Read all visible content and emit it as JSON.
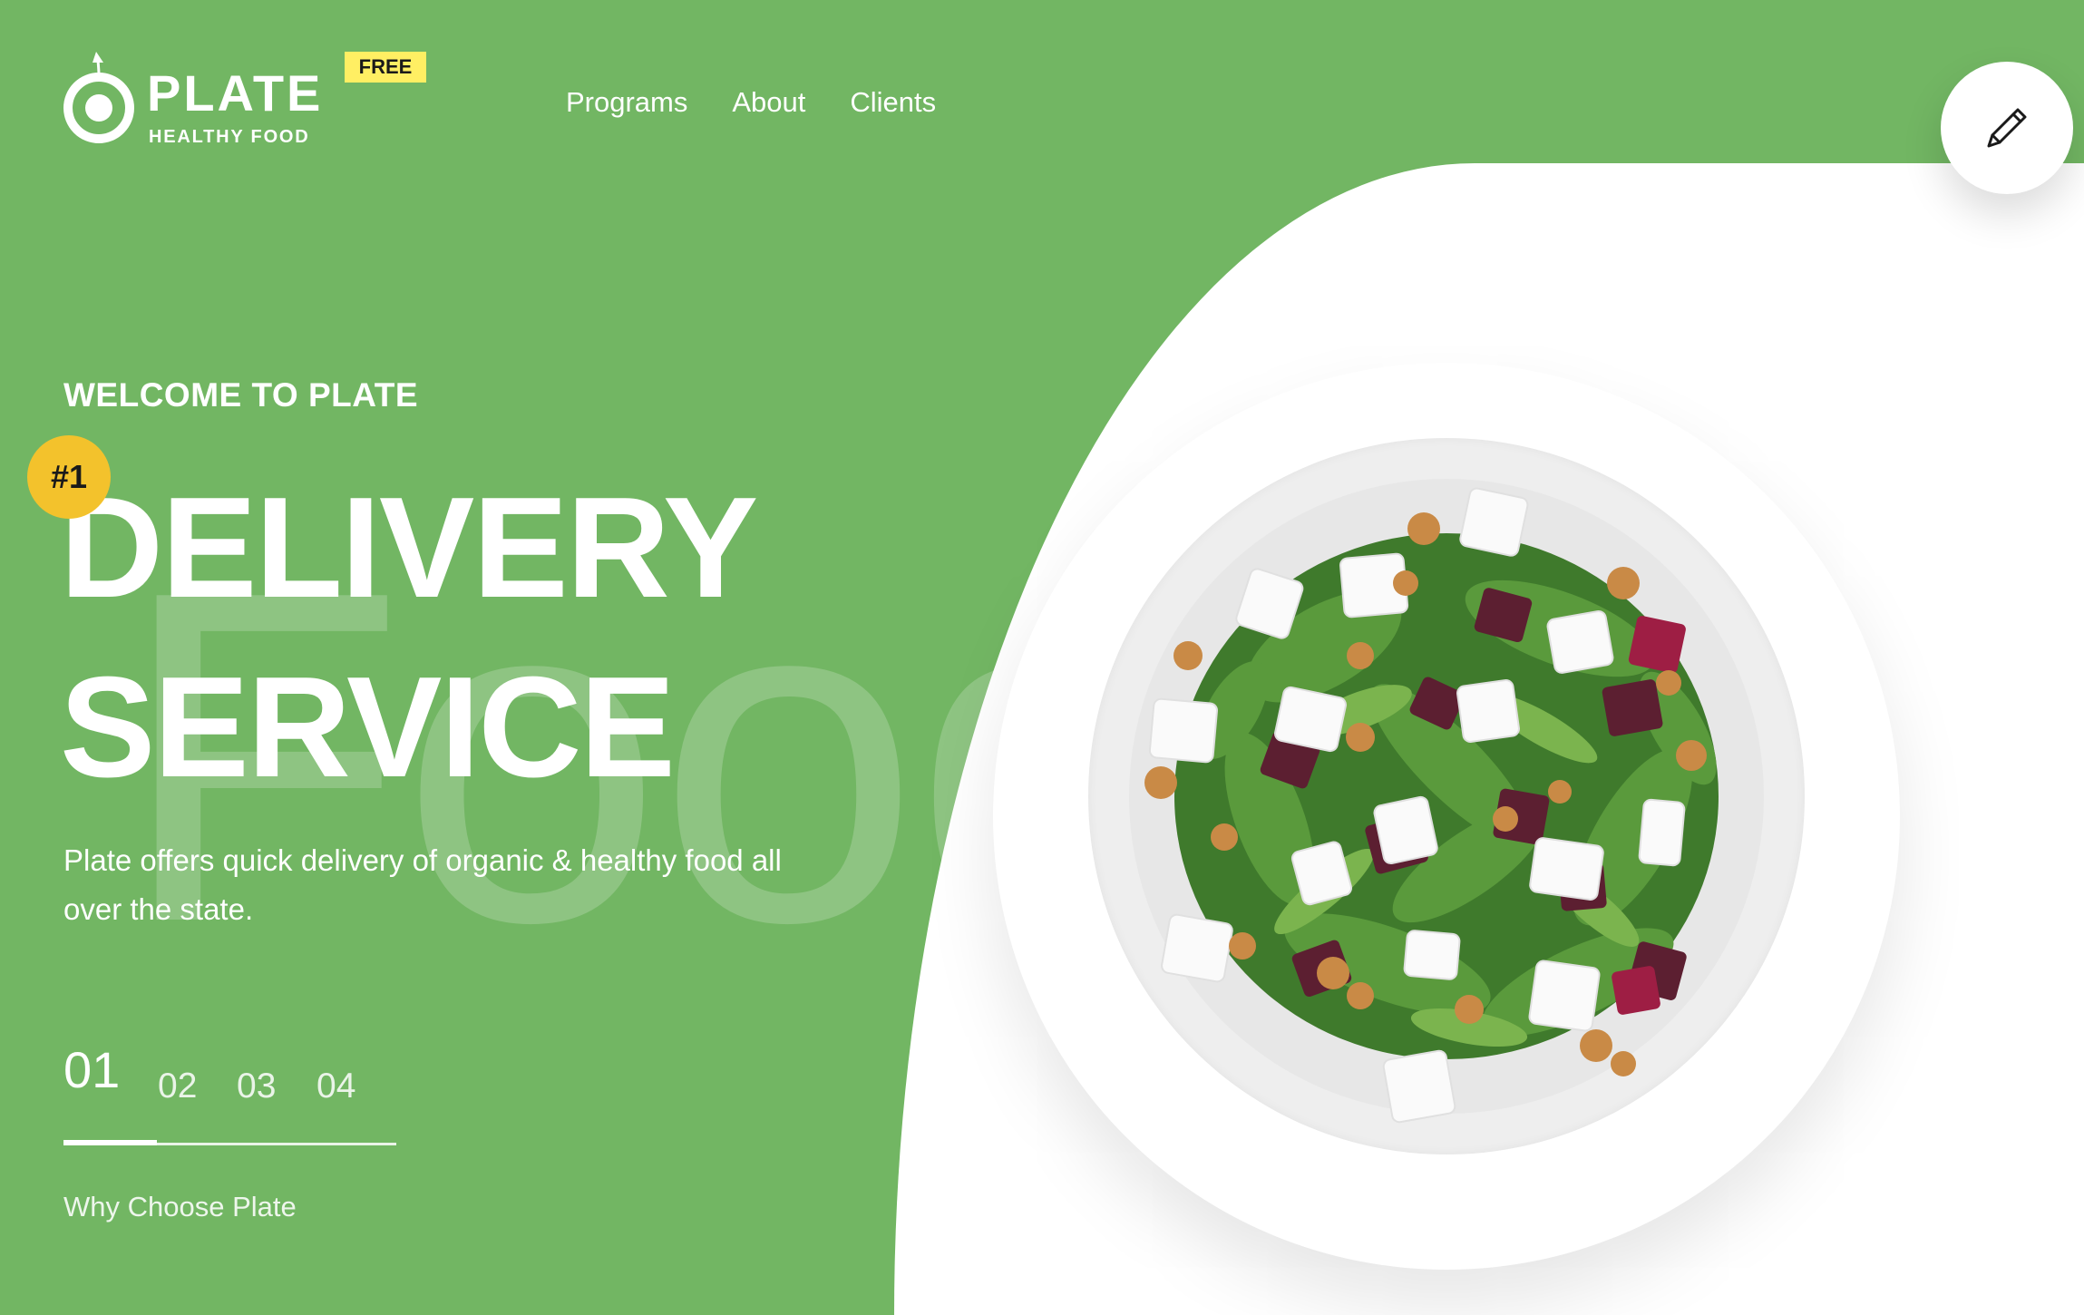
{
  "colors": {
    "brand_green": "#72b663",
    "badge_yellow": "#ffef63",
    "rank_yellow": "#f3c22c",
    "white": "#ffffff"
  },
  "logo": {
    "name": "PLATE",
    "tagline": "HEALTHY FOOD",
    "badge": "FREE",
    "icon": "apple-ring-icon"
  },
  "nav": {
    "items": [
      {
        "label": "Programs"
      },
      {
        "label": "About"
      },
      {
        "label": "Clients"
      }
    ]
  },
  "edit_button": {
    "icon": "pencil-icon"
  },
  "hero": {
    "eyebrow": "WELCOME TO PLATE",
    "badge": "#1",
    "headline_line1": "DELIVERY",
    "headline_line2": "SERVICE",
    "background_word": "Food",
    "description": "Plate offers quick delivery of organic & healthy food all over the state."
  },
  "slider": {
    "numbers": [
      "01",
      "02",
      "03",
      "04"
    ],
    "active_index": 0,
    "progress_fraction": 0.28,
    "caption": "Why Choose Plate"
  },
  "image": {
    "subject": "salad bowl with arugula, beets, feta cubes and walnuts"
  }
}
